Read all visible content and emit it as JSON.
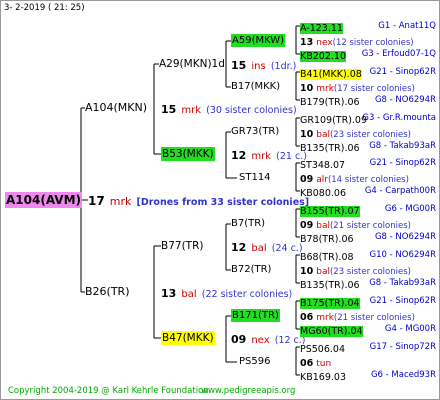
{
  "header": {
    "date": "3-  2-2019 ( 21: 25)"
  },
  "footer": {
    "copyright": "Copyright 2004-2019 @ Karl Kehrle Foundation",
    "site": "www.pedigreeapis.org"
  },
  "root": {
    "name": "A104(AVM)",
    "num": "17",
    "code": "mrk",
    "desc": "[Drones from 33 sister colonies]"
  },
  "p2": [
    {
      "name": "A104(MKN)",
      "num": "15",
      "code": "mrk",
      "desc": "(30 sister colonies)"
    },
    {
      "name": "B26(TR)",
      "num": "13",
      "code": "bal",
      "desc": "(22 sister colonies)"
    }
  ],
  "p4": [
    {
      "name": "A29(MKN)1d",
      "num": "15",
      "code": "ins",
      "desc": "(1dr.)"
    },
    {
      "name": "B53(MKK)",
      "num": "12",
      "code": "mrk",
      "desc": "(21 c.)"
    },
    {
      "name": "B77(TR)",
      "num": "12",
      "code": "bal",
      "desc": "(24 c.)"
    },
    {
      "name": "B47(MKK)",
      "num": "09",
      "code": "nex",
      "desc": "(12 c.)"
    }
  ],
  "p8": [
    {
      "name": "A59(MKW)"
    },
    {
      "name": "B17(MKK)"
    },
    {
      "name": "GR73(TR)"
    },
    {
      "name": "ST114"
    },
    {
      "name": "B7(TR)"
    },
    {
      "name": "B72(TR)"
    },
    {
      "name": "B171(TR)"
    },
    {
      "name": "PS596"
    }
  ],
  "p16": [
    {
      "name": "A-123.11",
      "desc": "G1 - Anat11Q"
    },
    {
      "name": "13",
      "code": "nex",
      "extra": "(12 sister colonies)"
    },
    {
      "name": "KB202.10",
      "desc": "G3 - Erfoud07-1Q"
    },
    {
      "name": "B41(MKK).08",
      "desc": "G21 - Sinop62R"
    },
    {
      "name": "10",
      "code": "mrk",
      "extra": "(17 sister colonies)"
    },
    {
      "name": "B179(TR).06",
      "desc": "G8 - NO6294R"
    },
    {
      "name": "GR109(TR).09",
      "desc": "G3 - Gr.R.mounta"
    },
    {
      "name": "10",
      "code": "bal",
      "extra": "(23 sister colonies)"
    },
    {
      "name": "B135(TR).06",
      "desc": "G8 - Takab93aR"
    },
    {
      "name": "ST348.07",
      "desc": "G21 - Sinop62R"
    },
    {
      "name": "09",
      "code": "alr",
      "extra": "(14 sister colonies)"
    },
    {
      "name": "KB080.06",
      "desc": "G4 - Carpath00R"
    },
    {
      "name": "B155(TR).07",
      "desc": "G6 - MG00R"
    },
    {
      "name": "09",
      "code": "bal",
      "extra": "(21 sister colonies)"
    },
    {
      "name": "B78(TR).06",
      "desc": "G8 - NO6294R"
    },
    {
      "name": "B68(TR).08",
      "desc": "G10 - NO6294R"
    },
    {
      "name": "10",
      "code": "bal",
      "extra": "(23 sister colonies)"
    },
    {
      "name": "B135(TR).06",
      "desc": "G8 - Takab93aR"
    },
    {
      "name": "B175(TR).04",
      "desc": "G21 - Sinop62R"
    },
    {
      "name": "06",
      "code": "mrk",
      "extra": "(21 sister colonies)"
    },
    {
      "name": "MG60(TR).04",
      "desc": "G4 - MG00R"
    },
    {
      "name": "PS506.04",
      "desc": "G17 - Sinop72R"
    },
    {
      "name": "06",
      "code": "tun",
      "extra": ""
    },
    {
      "name": "KB169.03",
      "desc": "G6 - Maced93R"
    }
  ],
  "colors": {
    "line": "#000000",
    "yellow": "#ffff00",
    "green": "#22dd22",
    "magenta": "#ee88ee",
    "code": "#cc0000",
    "desc": "#3333cc",
    "footer": "#00aa00"
  }
}
